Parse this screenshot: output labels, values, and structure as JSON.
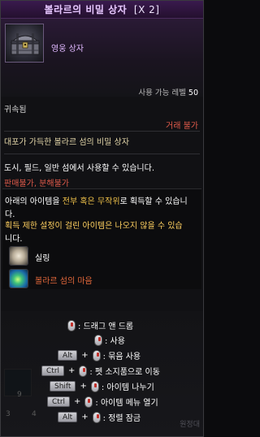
{
  "title": {
    "name": "볼라르의 비밀 상자",
    "count": "[X 2]"
  },
  "item": {
    "grade": "영웅 상자",
    "req_level_label": "사용 가능 레벨",
    "req_level_value": "50",
    "binding": "귀속됨",
    "trade": "거래 불가",
    "desc1": "대포가 가득한 볼라르 섬의 비밀 상자",
    "desc2": "도시, 필드, 일반 섬에서 사용할 수 있습니다.",
    "restrict1": "판매불가",
    "restrict_sep": ", ",
    "restrict2": "분해불가"
  },
  "contents": {
    "line1_pre": "아래의 아이템을 ",
    "line1_hl": "전부 혹은 무작위",
    "line1_post": "로 획득할 수 있습니",
    "line2": "다.",
    "line3": "획득 제한 설정이 걸린 아이템은 나오지 않을 수 있습",
    "line4": "니다.",
    "rewards": [
      {
        "label": "실링",
        "color": "#ffffff"
      },
      {
        "label": "볼라르 섬의 마음",
        "color": "#e3683a"
      }
    ]
  },
  "controls": {
    "drag": ": 드래그 앤 드롭",
    "use": ": 사용",
    "alt_key": "Alt",
    "bulk_use": ": 묶음 사용",
    "ctrl_key": "Ctrl",
    "move_slot": ": 펫 소지품으로 이동",
    "shift_key": "Shift",
    "split": ": 아이템 나누기",
    "menu": ": 아이템 메뉴 열기",
    "lock": ": 정렬 잠금"
  },
  "background": {
    "num_9": "9",
    "num_3": "3",
    "num_4": "4",
    "label": "원정대"
  }
}
